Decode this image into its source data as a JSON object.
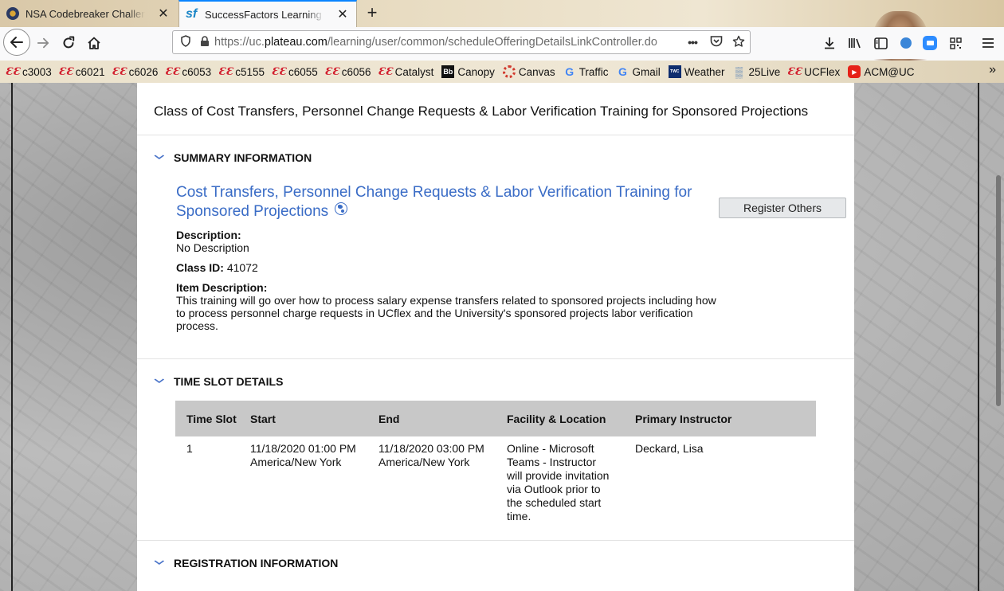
{
  "browser": {
    "tabs": [
      {
        "title": "NSA Codebreaker Challenge",
        "close": "✕",
        "favicon": "nsa-seal-icon"
      },
      {
        "title": "SuccessFactors Learning",
        "close": "✕",
        "favicon": "sf-logo-icon",
        "favicon_text": "sf"
      }
    ],
    "new_tab": "+",
    "url_host_prefix": "https://uc.",
    "url_host": "plateau.com",
    "url_path": "/learning/user/common/scheduleOfferingDetailsLinkController.do",
    "url_more": "•••"
  },
  "bookmarks": [
    {
      "label": "c3003",
      "icon": "uc-icon"
    },
    {
      "label": "c6021",
      "icon": "uc-icon"
    },
    {
      "label": "c6026",
      "icon": "uc-icon"
    },
    {
      "label": "c6053",
      "icon": "uc-icon"
    },
    {
      "label": "c5155",
      "icon": "uc-icon"
    },
    {
      "label": "c6055",
      "icon": "uc-icon"
    },
    {
      "label": "c6056",
      "icon": "uc-icon"
    },
    {
      "label": "Catalyst",
      "icon": "uc-icon"
    },
    {
      "label": "Canopy",
      "icon": "blackboard-icon"
    },
    {
      "label": "Canvas",
      "icon": "canvas-icon"
    },
    {
      "label": "Traffic",
      "icon": "google-icon"
    },
    {
      "label": "Gmail",
      "icon": "google-icon"
    },
    {
      "label": "Weather",
      "icon": "weather-channel-icon"
    },
    {
      "label": "25Live",
      "icon": "25live-icon"
    },
    {
      "label": "UCFlex",
      "icon": "uc-icon"
    },
    {
      "label": "ACM@UC",
      "icon": "youtube-icon"
    }
  ],
  "page": {
    "title": "Class of Cost Transfers, Personnel Change Requests & Labor Verification Training for Sponsored Projections",
    "summary": {
      "heading": "SUMMARY INFORMATION",
      "course_title": "Cost Transfers, Personnel Change Requests & Labor Verification Training for Sponsored Projections",
      "register_button": "Register Others",
      "description_label": "Description:",
      "description_value": "No Description",
      "class_id_label": "Class ID:",
      "class_id_value": "41072",
      "item_description_label": "Item Description:",
      "item_description_value": "This training will go over how to process salary expense transfers related to sponsored projects including how to process personnel charge requests in UCflex and the University's sponsored projects labor verification process."
    },
    "time_slot": {
      "heading": "TIME SLOT DETAILS",
      "columns": [
        "Time Slot",
        "Start",
        "End",
        "Facility & Location",
        "Primary Instructor"
      ],
      "rows": [
        [
          "1",
          "11/18/2020 01:00 PM America/New York",
          "11/18/2020 03:00 PM America/New York",
          "Online - Microsoft Teams - Instructor will provide invitation via Outlook prior to the scheduled start time.",
          "Deckard, Lisa"
        ]
      ]
    },
    "registration": {
      "heading": "REGISTRATION INFORMATION"
    }
  }
}
